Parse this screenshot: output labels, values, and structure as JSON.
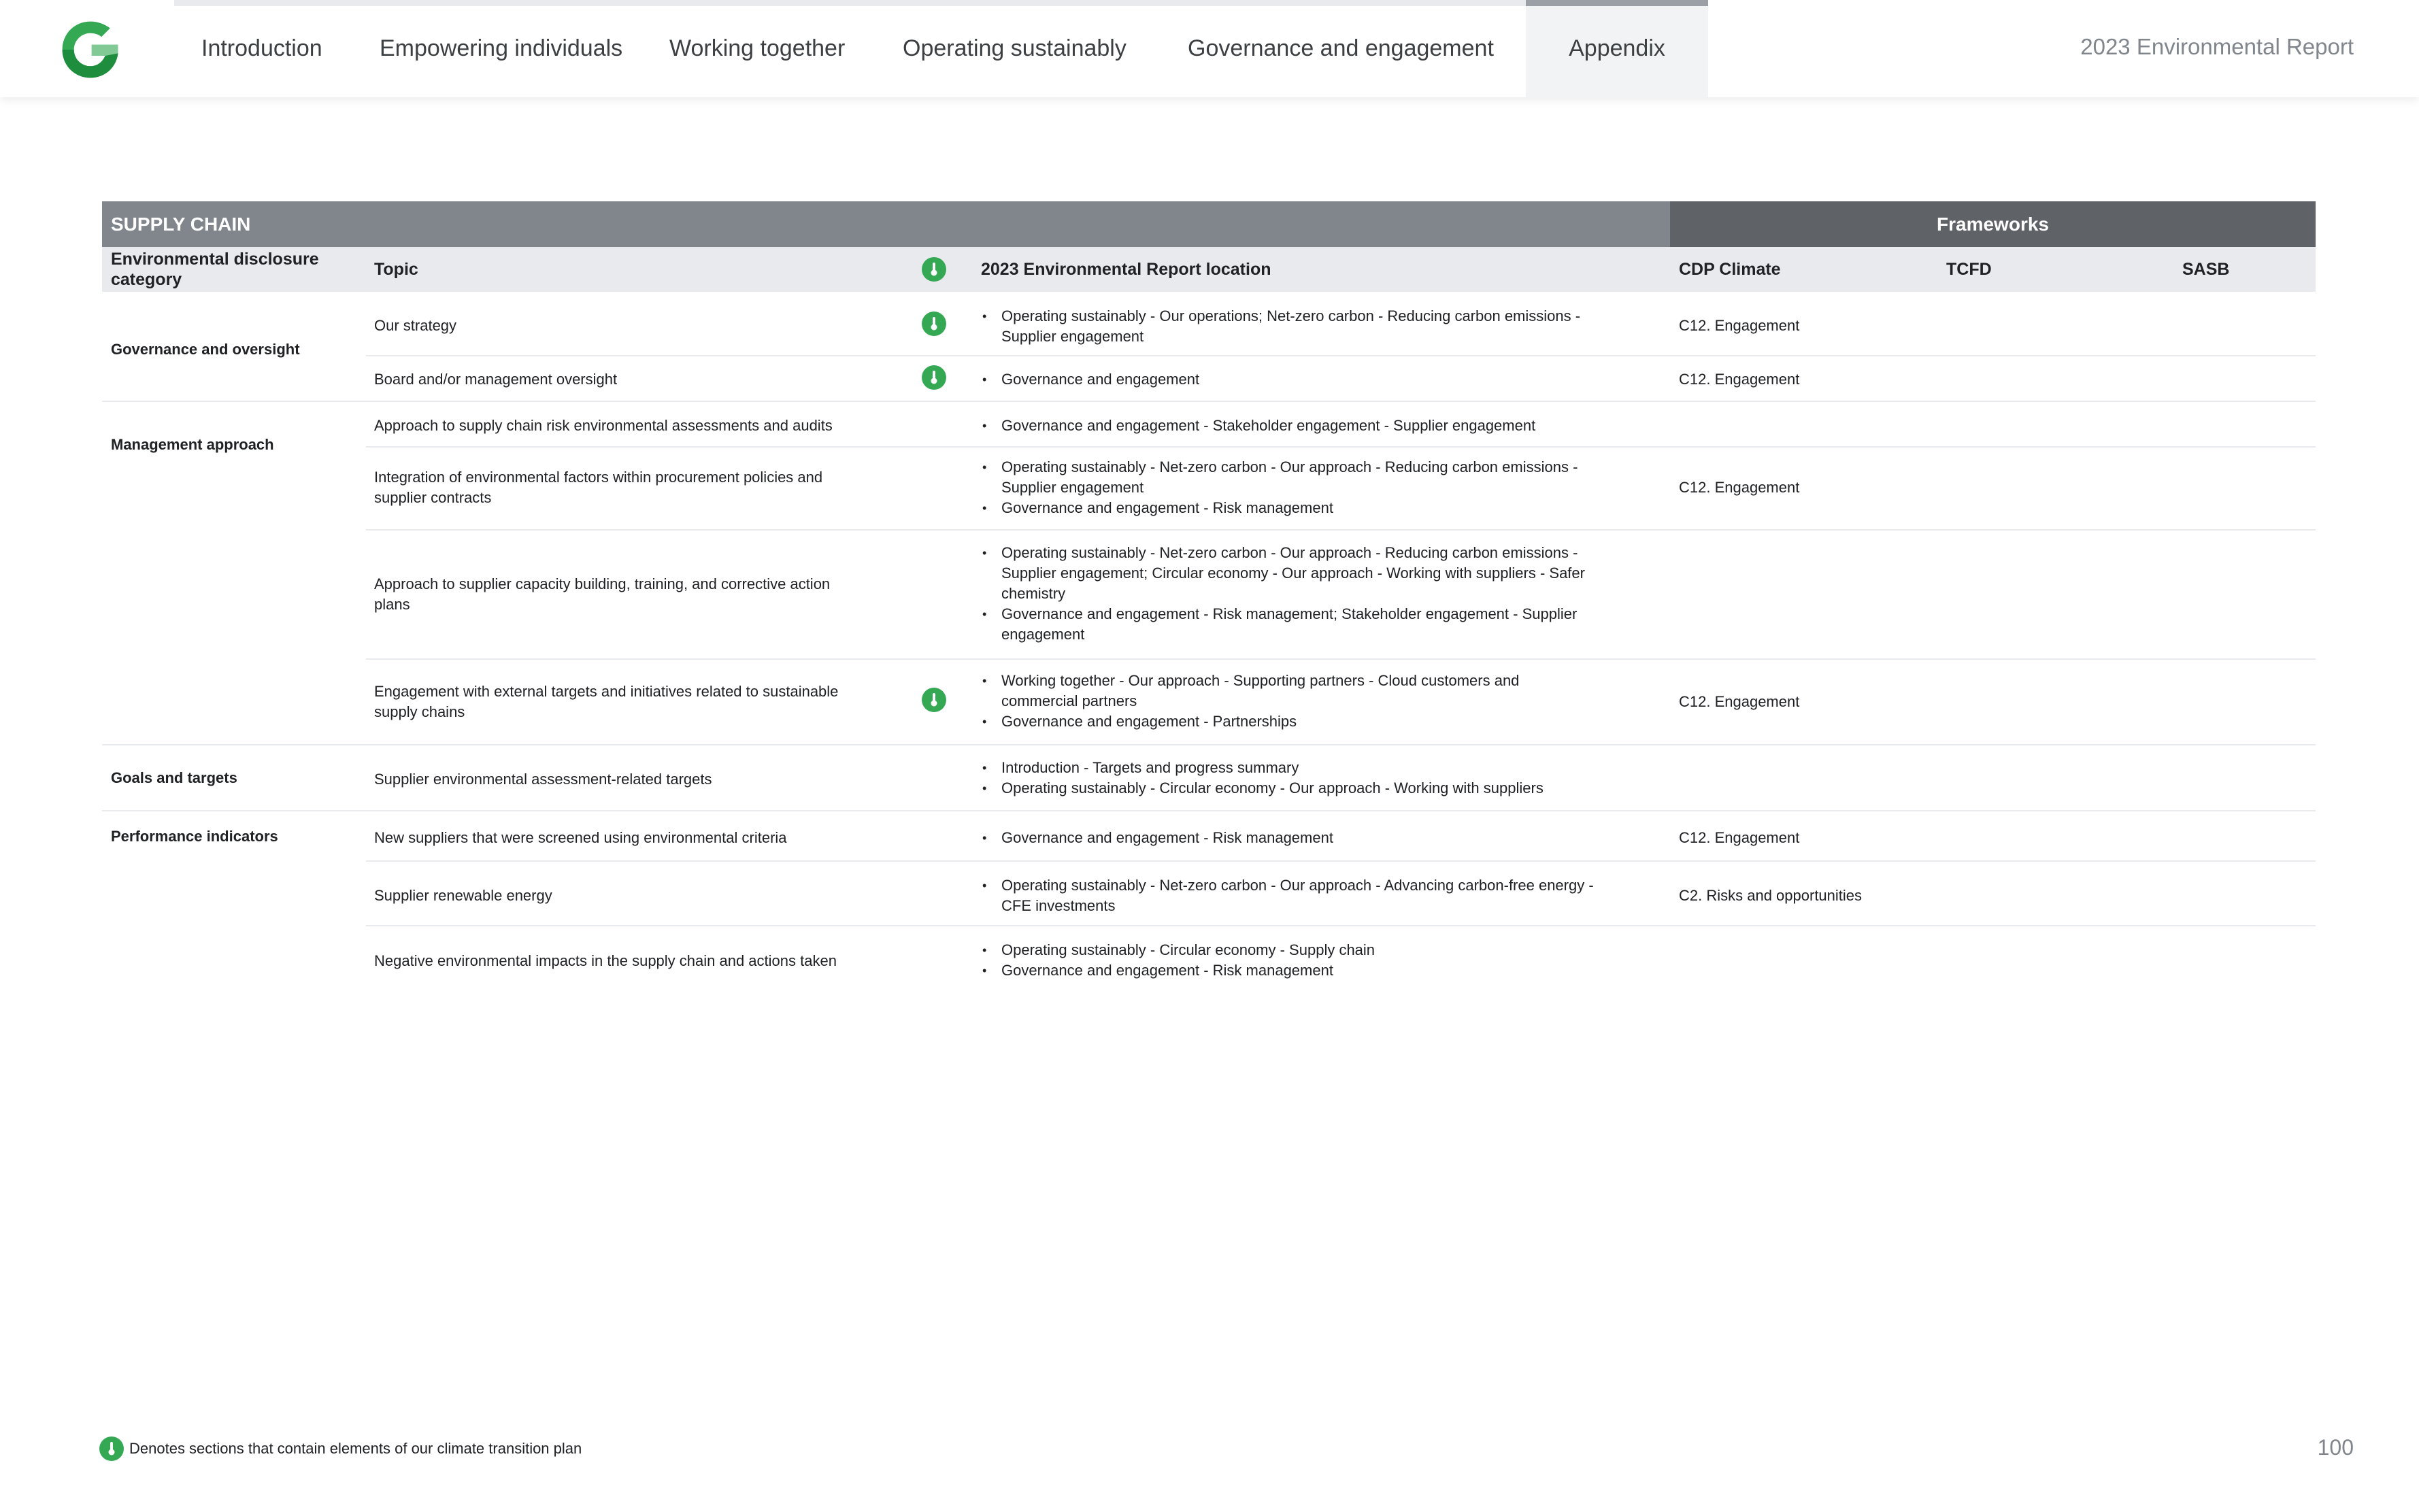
{
  "nav": {
    "tabs": [
      {
        "label": "Introduction"
      },
      {
        "label": "Empowering individuals"
      },
      {
        "label": "Working together"
      },
      {
        "label": "Operating sustainably"
      },
      {
        "label": "Governance and engagement"
      },
      {
        "label": "Appendix",
        "active": true
      }
    ],
    "report_title": "2023 Environmental Report"
  },
  "table": {
    "section_title": "SUPPLY CHAIN",
    "frameworks_title": "Frameworks",
    "headers": {
      "category": "Environmental disclosure category",
      "topic": "Topic",
      "location": "2023 Environmental Report location",
      "cdp": "CDP Climate",
      "tcfd": "TCFD",
      "sasb": "SASB"
    },
    "categories": [
      "Governance and oversight",
      "Management approach",
      "Goals and targets",
      "Performance indicators"
    ],
    "rows": [
      {
        "topic": "Our strategy",
        "climate": true,
        "locations": [
          "Operating sustainably - Our operations; Net-zero carbon - Reducing carbon emissions - Supplier engagement"
        ],
        "cdp": "C12. Engagement"
      },
      {
        "topic": "Board and/or management oversight",
        "climate": true,
        "locations": [
          "Governance and engagement"
        ],
        "cdp": "C12. Engagement"
      },
      {
        "topic": "Approach to supply chain risk environmental assessments and audits",
        "climate": false,
        "locations": [
          "Governance and engagement - Stakeholder engagement - Supplier engagement"
        ],
        "cdp": ""
      },
      {
        "topic": "Integration of environmental factors within procurement policies and supplier contracts",
        "climate": false,
        "locations": [
          "Operating sustainably - Net-zero carbon - Our approach - Reducing carbon emissions - Supplier engagement",
          "Governance and engagement - Risk management"
        ],
        "cdp": "C12. Engagement"
      },
      {
        "topic": "Approach to supplier capacity building, training, and corrective action plans",
        "climate": false,
        "locations": [
          "Operating sustainably - Net-zero carbon - Our approach - Reducing carbon emissions - Supplier engagement; Circular economy - Our approach - Working with suppliers - Safer chemistry",
          "Governance and engagement - Risk management; Stakeholder engagement - Supplier engagement"
        ],
        "cdp": ""
      },
      {
        "topic": "Engagement with external targets and initiatives related to sustainable supply chains",
        "climate": true,
        "locations": [
          "Working together - Our approach - Supporting partners - Cloud customers and commercial partners",
          "Governance and engagement - Partnerships"
        ],
        "cdp": "C12. Engagement"
      },
      {
        "topic": "Supplier environmental assessment-related targets",
        "climate": false,
        "locations": [
          "Introduction - Targets and progress summary",
          "Operating sustainably - Circular economy - Our approach - Working with suppliers"
        ],
        "cdp": ""
      },
      {
        "topic": "New suppliers that were screened using environmental criteria",
        "climate": false,
        "locations": [
          "Governance and engagement - Risk management"
        ],
        "cdp": "C12. Engagement"
      },
      {
        "topic": "Supplier renewable energy",
        "climate": false,
        "locations": [
          "Operating sustainably - Net-zero carbon - Our approach - Advancing carbon-free energy - CFE investments"
        ],
        "cdp": "C2. Risks and opportunities"
      },
      {
        "topic": "Negative environmental impacts in the supply chain and actions taken",
        "climate": false,
        "locations": [
          "Operating sustainably - Circular economy - Supply chain",
          "Governance and engagement - Risk management"
        ],
        "cdp": ""
      }
    ]
  },
  "footer": {
    "note": "Denotes sections that contain elements of our climate transition plan",
    "page_number": "100"
  },
  "icons": {
    "climate_marker": "thermometer-icon",
    "logo": "google-g-logo"
  },
  "colors": {
    "section_bar": "#80868b",
    "frameworks_bar": "#5f6368",
    "header_row": "#e8eaed",
    "climate_marker": "#34a853"
  }
}
